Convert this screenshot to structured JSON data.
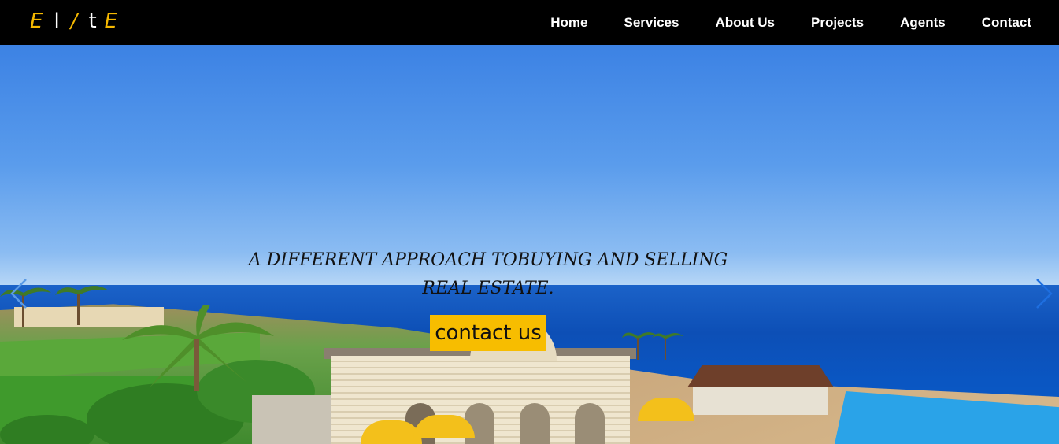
{
  "brand": {
    "logo_letters": [
      "E",
      "l",
      "/",
      "t",
      "E"
    ],
    "accent_color": "#f5b800"
  },
  "nav": {
    "items": [
      {
        "label": "Home"
      },
      {
        "label": "Services"
      },
      {
        "label": "About Us"
      },
      {
        "label": "Projects"
      },
      {
        "label": "Agents"
      },
      {
        "label": "Contact"
      }
    ]
  },
  "hero": {
    "tagline": "A DIFFERENT APPROACH TOBUYING AND SELLING REAL ESTATE.",
    "cta_label": "contact us",
    "cta_color": "#f7bd00",
    "prev_icon": "chevron-left-icon",
    "next_icon": "chevron-right-icon",
    "arrow_color": "#1e6fe0"
  }
}
